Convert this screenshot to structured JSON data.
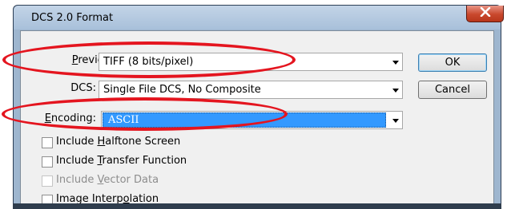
{
  "window": {
    "title": "DCS 2.0 Format",
    "close_icon": "close-icon",
    "close_color": "#c9482d"
  },
  "fields": {
    "preview": {
      "label_prefix": "",
      "label_ul": "P",
      "label_rest": "review:",
      "value": "TIFF  (8 bits/pixel)"
    },
    "dcs": {
      "label": "DCS:",
      "value": "Single File DCS, No Composite"
    },
    "encoding": {
      "label_ul": "E",
      "label_rest": "ncoding:",
      "value": "ASCII"
    }
  },
  "buttons": {
    "ok": "OK",
    "cancel": "Cancel"
  },
  "checkboxes": [
    {
      "pre": "Include ",
      "ul": "H",
      "post": "alftone Screen",
      "checked": false,
      "enabled": true
    },
    {
      "pre": "Include ",
      "ul": "T",
      "post": "ransfer Function",
      "checked": false,
      "enabled": true
    },
    {
      "pre": "Include ",
      "ul": "V",
      "post": "ector Data",
      "checked": false,
      "enabled": false
    },
    {
      "pre": "Image Interp",
      "ul": "o",
      "post": "lation",
      "checked": false,
      "enabled": true
    }
  ],
  "annotation_color": "#e4151f"
}
